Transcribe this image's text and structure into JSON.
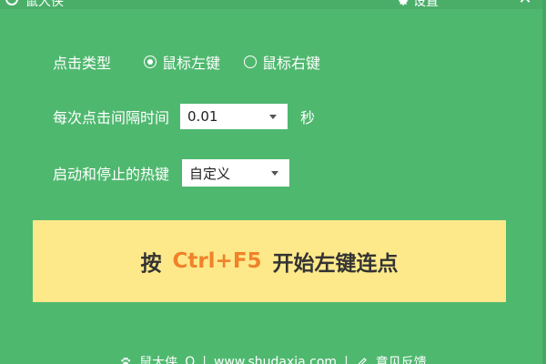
{
  "titlebar": {
    "title": "鼠大侠",
    "settings_label": "设置",
    "close_glyph": "✕"
  },
  "click_type": {
    "label": "点击类型",
    "options": [
      {
        "label": "鼠标左键",
        "checked": true
      },
      {
        "label": "鼠标右键",
        "checked": false
      }
    ]
  },
  "interval": {
    "label": "每次点击间隔时间",
    "value": "0.01",
    "unit": "秒"
  },
  "hotkey": {
    "label": "启动和停止的热键",
    "value": "自定义"
  },
  "start_banner": {
    "prefix": "按",
    "hotkey": "Ctrl+F5",
    "suffix": "开始左键连点"
  },
  "footer": {
    "brand": "鼠大侠",
    "qq": "Q",
    "site": "www.shudaxia.com",
    "feedback": "意见反馈",
    "separator": "|"
  },
  "colors": {
    "background": "#4fb86f",
    "banner": "#fde98a",
    "hotkey_accent": "#f0822a"
  }
}
